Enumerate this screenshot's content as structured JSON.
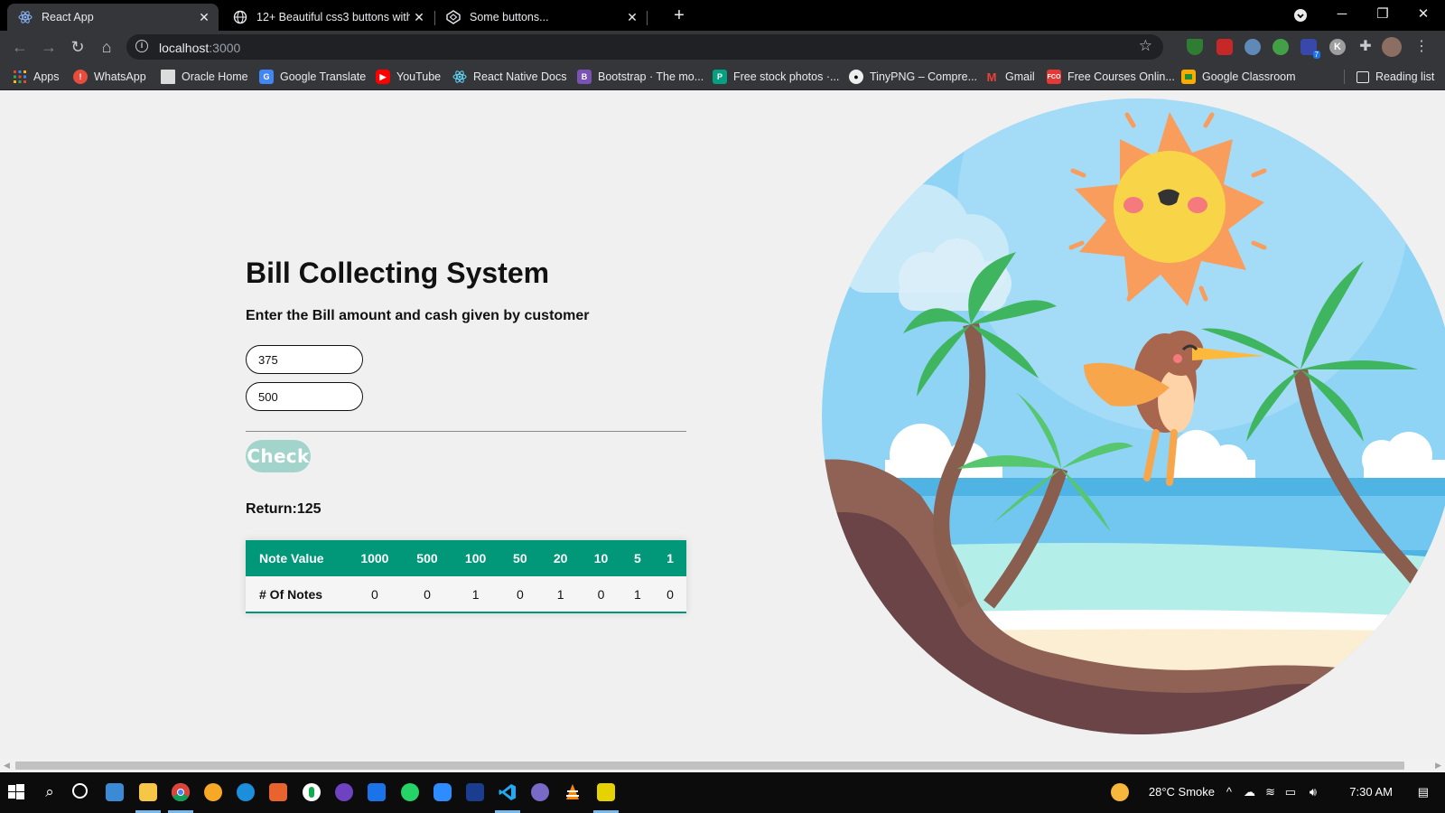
{
  "browser": {
    "tabs": [
      {
        "title": "React App",
        "active": true,
        "icon": "react-icon"
      },
      {
        "title": "12+ Beautiful css3 buttons with h",
        "active": false,
        "icon": "globe-icon"
      },
      {
        "title": "Some buttons...",
        "active": false,
        "icon": "codepen-icon"
      }
    ],
    "address": {
      "host": "localhost",
      "port": ":3000"
    },
    "bookmarks": [
      {
        "label": "Apps",
        "icon": "apps-grid-icon",
        "color": "#4285f4"
      },
      {
        "label": "WhatsApp",
        "icon": "whatsapp-icon",
        "color": "#e74c3c"
      },
      {
        "label": "Oracle Home",
        "icon": "page-icon",
        "color": "#dddddd"
      },
      {
        "label": "Google Translate",
        "icon": "translate-icon",
        "color": "#4285f4"
      },
      {
        "label": "YouTube",
        "icon": "youtube-icon",
        "color": "#ff0000"
      },
      {
        "label": "React Native Docs",
        "icon": "react-icon",
        "color": "#61dafb"
      },
      {
        "label": "Bootstrap · The mo...",
        "icon": "bootstrap-icon",
        "color": "#7952b3"
      },
      {
        "label": "Free stock photos ·...",
        "icon": "pexels-icon",
        "color": "#05a081"
      },
      {
        "label": "TinyPNG – Compre...",
        "icon": "panda-icon",
        "color": "#eeeeee"
      },
      {
        "label": "Gmail",
        "icon": "gmail-icon",
        "color": "#ea4335"
      },
      {
        "label": "Free Courses Onlin...",
        "icon": "fco-icon",
        "color": "#e53935"
      },
      {
        "label": "Google Classroom",
        "icon": "classroom-icon",
        "color": "#f9ab00"
      }
    ],
    "reading_list": "Reading list"
  },
  "app": {
    "title": "Bill Collecting System",
    "subtitle": "Enter the Bill amount and cash given by customer",
    "bill_amount": "375",
    "cash_given": "500",
    "check_label": "Check",
    "return_text": "Return:125",
    "table": {
      "row1_label": "Note Value",
      "row2_label": "# Of Notes",
      "note_values": [
        "1000",
        "500",
        "100",
        "50",
        "20",
        "10",
        "5",
        "1"
      ],
      "note_counts": [
        "0",
        "0",
        "1",
        "0",
        "1",
        "0",
        "1",
        "0"
      ]
    },
    "accent_color": "#009879"
  },
  "taskbar": {
    "weather": "28°C  Smoke",
    "time": "7:30 AM"
  }
}
